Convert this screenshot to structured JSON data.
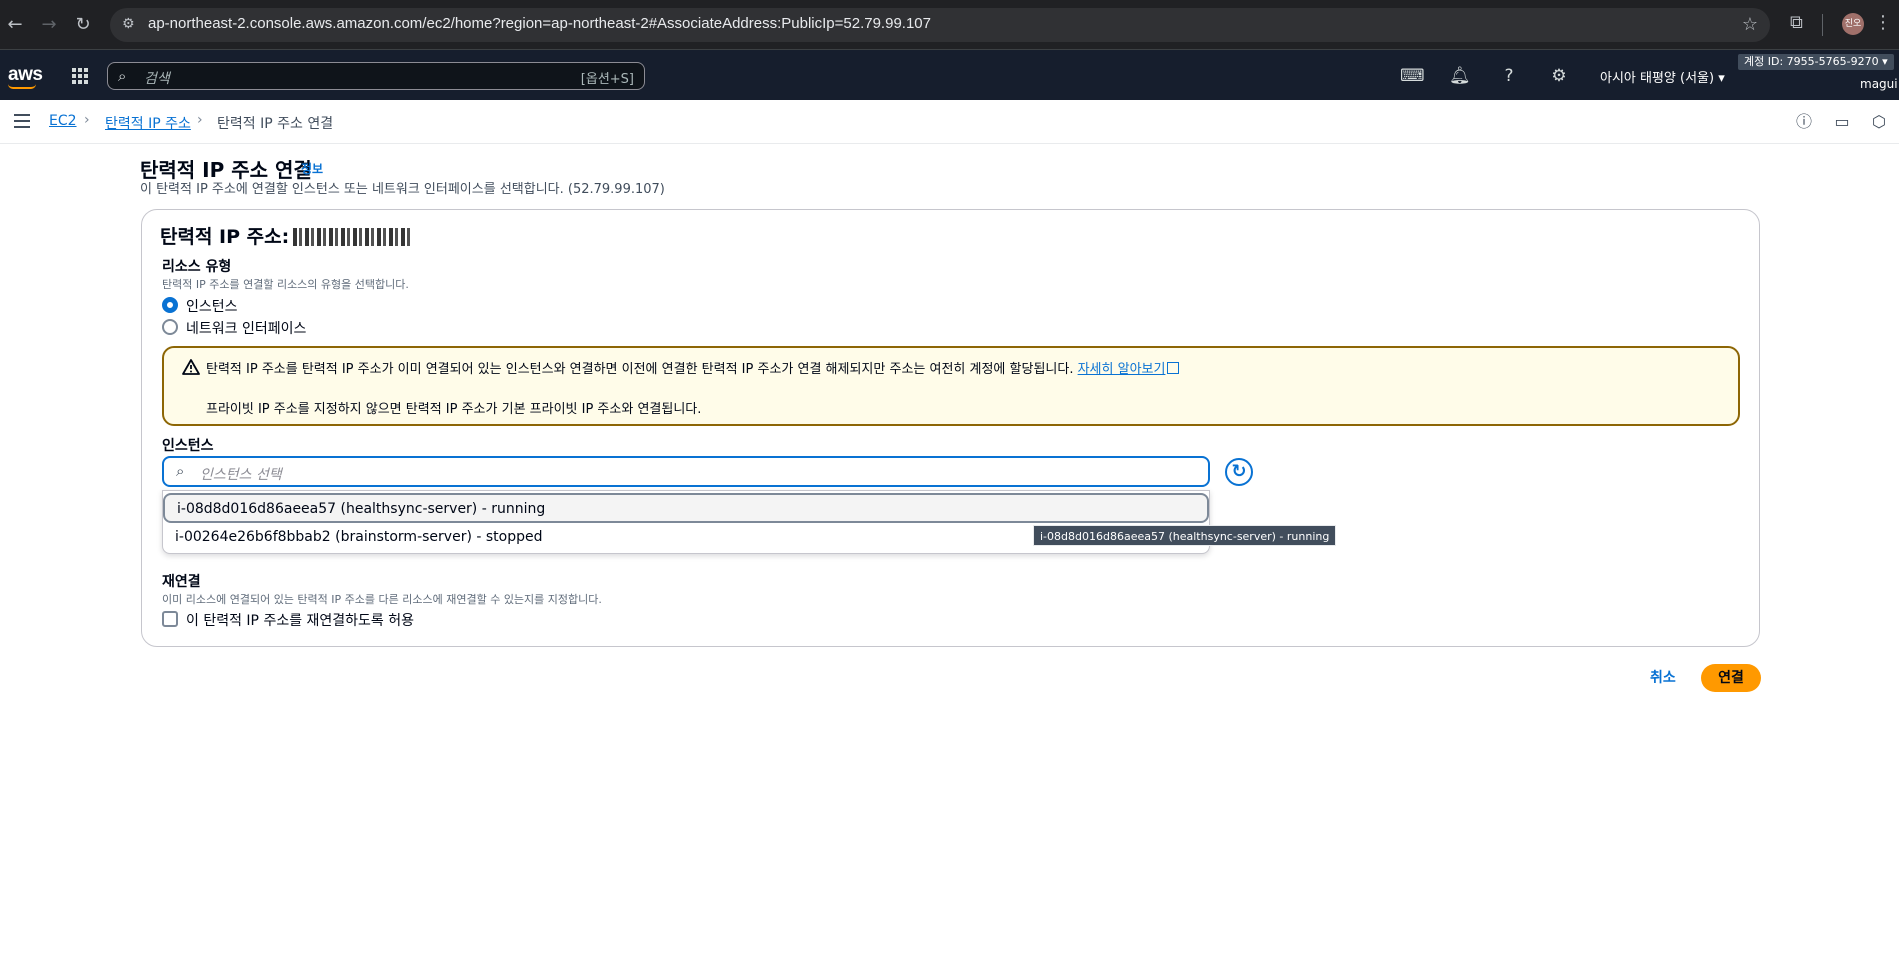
{
  "browser": {
    "url": "ap-northeast-2.console.aws.amazon.com/ec2/home?region=ap-northeast-2#AssociateAddress:PublicIp=52.79.99.107",
    "profile_initials": "진오"
  },
  "header": {
    "logo": "aws",
    "search_placeholder": "검색",
    "search_shortcut": "[옵션+S]",
    "region": "아시아 태평양 (서울)",
    "account": "계정 ID: 7955-5765-9270",
    "user": "magui"
  },
  "breadcrumb": {
    "items": [
      "EC2",
      "탄력적 IP 주소",
      "탄력적 IP 주소 연결"
    ]
  },
  "page": {
    "title": "탄력적 IP 주소 연결",
    "info": "정보",
    "description": "이 탄력적 IP 주소에 연결할 인스턴스 또는 네트워크 인터페이스를 선택합니다. (52.79.99.107)"
  },
  "panel": {
    "title": "탄력적 IP 주소:",
    "resource_type": {
      "label": "리소스 유형",
      "description": "탄력적 IP 주소를 연결할 리소스의 유형을 선택합니다.",
      "options": [
        "인스턴스",
        "네트워크 인터페이스"
      ],
      "selected": "인스턴스"
    },
    "alert": {
      "line1": "탄력적 IP 주소를 탄력적 IP 주소가 이미 연결되어 있는 인스턴스와 연결하면 이전에 연결한 탄력적 IP 주소가 연결 해제되지만 주소는 여전히 계정에 할당됩니다.",
      "link": "자세히 알아보기",
      "line2": "프라이빗 IP 주소를 지정하지 않으면 탄력적 IP 주소가 기본 프라이빗 IP 주소와 연결됩니다."
    },
    "instance": {
      "label": "인스턴스",
      "placeholder": "인스턴스 선택",
      "options": [
        "i-08d8d016d86aeea57 (healthsync-server) - running",
        "i-00264e26b6f8bbab2 (brainstorm-server) - stopped"
      ],
      "tooltip": "i-08d8d016d86aeea57 (healthsync-server) - running"
    },
    "reassociation": {
      "label": "재연결",
      "description": "이미 리소스에 연결되어 있는 탄력적 IP 주소를 다른 리소스에 재연결할 수 있는지를 지정합니다.",
      "checkbox_label": "이 탄력적 IP 주소를 재연결하도록 허용",
      "checked": false
    }
  },
  "actions": {
    "cancel": "취소",
    "submit": "연결"
  },
  "colors": {
    "accent": "#0972d3",
    "primary_button": "#ff9900",
    "header_bg": "#161e2d",
    "warning_border": "#8d6605"
  }
}
